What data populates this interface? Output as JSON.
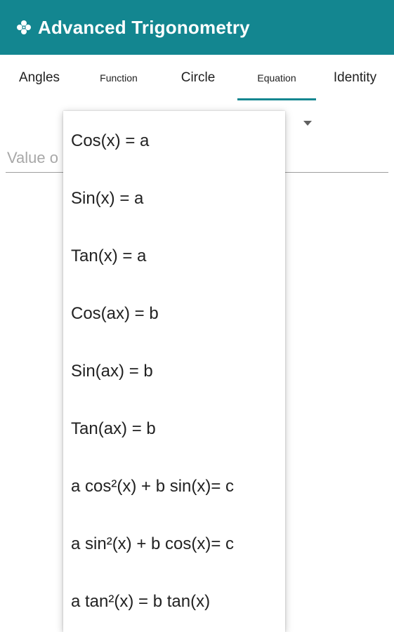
{
  "app": {
    "title": "Advanced Trigonometry",
    "icon": "flower-icon",
    "accent_color": "#138690"
  },
  "tabs": [
    {
      "label": "Angles",
      "selected": false
    },
    {
      "label": "Function",
      "selected": false
    },
    {
      "label": "Circle",
      "selected": false
    },
    {
      "label": "Equation",
      "selected": true
    },
    {
      "label": "Identity",
      "selected": false
    }
  ],
  "value_input": {
    "placeholder_visible": "Value o"
  },
  "dropdown": {
    "items": [
      "Cos(x) = a",
      "Sin(x) = a",
      "Tan(x) = a",
      "Cos(ax) = b",
      "Sin(ax) = b",
      "Tan(ax) = b",
      "a cos²(x) + b sin(x)= c",
      "a sin²(x) + b cos(x)= c",
      "a tan²(x) = b tan(x)"
    ]
  }
}
